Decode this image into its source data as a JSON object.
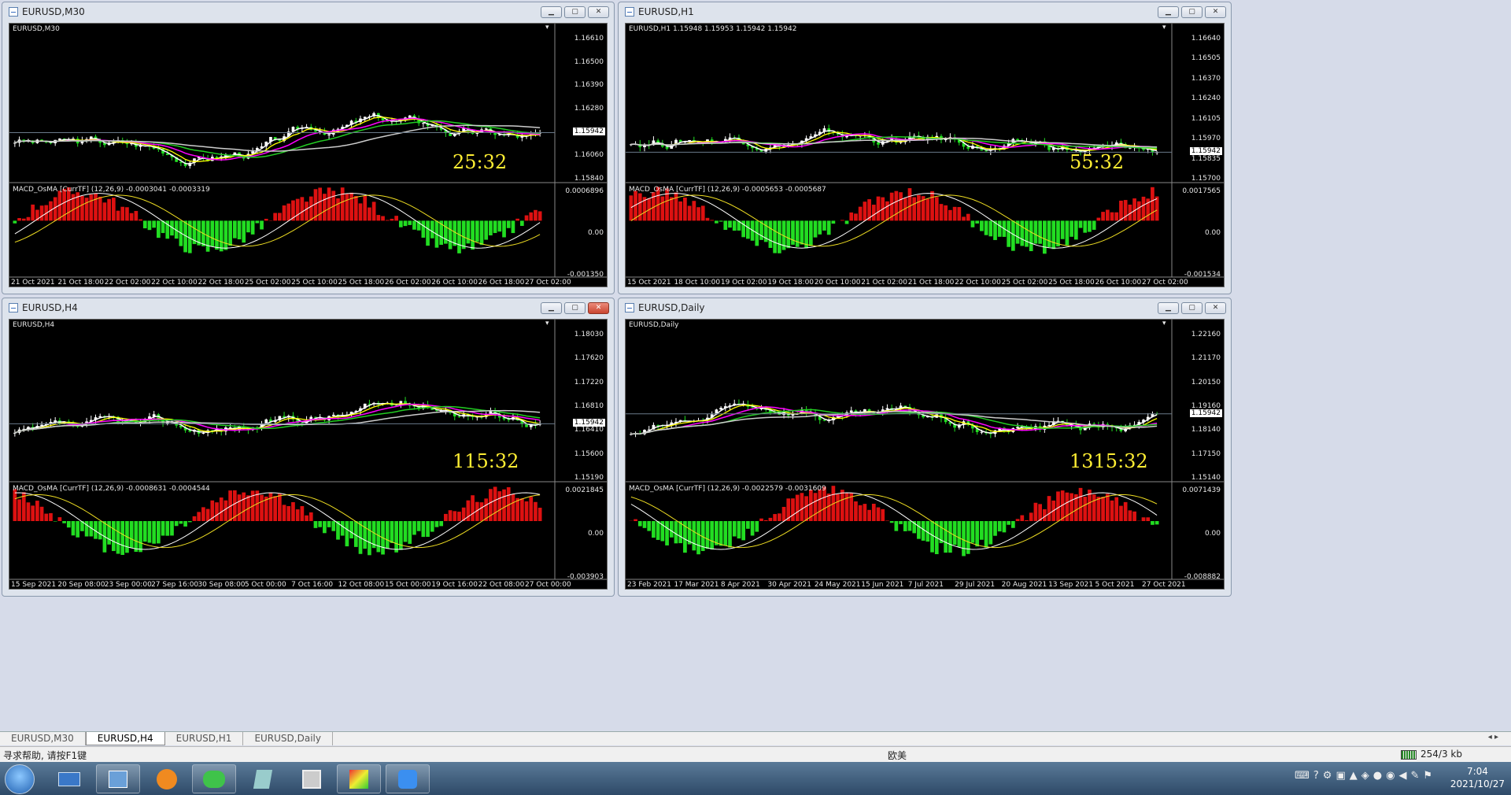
{
  "windows": [
    {
      "title": "EURUSD,M30",
      "header": "EURUSD,M30",
      "ind": "MACD_OsMA [CurrTF] (12,26,9) -0.0003041 -0.0003319",
      "timer": "25:32",
      "cur": "1.15942",
      "prices": [
        "1.16610",
        "1.16500",
        "1.16390",
        "1.16280",
        "1.16170",
        "1.16060",
        "1.15840"
      ],
      "ind_prices": [
        "0.0006896",
        "0.00",
        "-0.001350"
      ],
      "dates": [
        "21 Oct 2021",
        "21 Oct 18:00",
        "22 Oct 02:00",
        "22 Oct 10:00",
        "22 Oct 18:00",
        "25 Oct 02:00",
        "25 Oct 10:00",
        "25 Oct 18:00",
        "26 Oct 02:00",
        "26 Oct 10:00",
        "26 Oct 18:00",
        "27 Oct 02:00"
      ],
      "close_glyph": "x",
      "active": false
    },
    {
      "title": "EURUSD,H1",
      "header": "EURUSD,H1  1.15948 1.15953 1.15942 1.15942",
      "ind": "MACD_OsMA [CurrTF] (12,26,9) -0.0005653 -0.0005687",
      "timer": "55:32",
      "cur": "1.15942",
      "prices": [
        "1.16640",
        "1.16505",
        "1.16370",
        "1.16240",
        "1.16105",
        "1.15970",
        "1.15835",
        "1.15700"
      ],
      "ind_prices": [
        "0.0017565",
        "0.00",
        "-0.001534"
      ],
      "dates": [
        "15 Oct 2021",
        "18 Oct 10:00",
        "19 Oct 02:00",
        "19 Oct 18:00",
        "20 Oct 10:00",
        "21 Oct 02:00",
        "21 Oct 18:00",
        "22 Oct 10:00",
        "25 Oct 02:00",
        "25 Oct 18:00",
        "26 Oct 10:00",
        "27 Oct 02:00"
      ],
      "close_glyph": "x",
      "active": false
    },
    {
      "title": "EURUSD,H4",
      "header": "EURUSD,H4",
      "ind": "MACD_OsMA [CurrTF] (12,26,9) -0.0008631 -0.0004544",
      "timer": "115:32",
      "cur": "1.15942",
      "prices": [
        "1.18030",
        "1.17620",
        "1.17220",
        "1.16810",
        "1.16410",
        "1.15600",
        "1.15190"
      ],
      "ind_prices": [
        "0.0021845",
        "0.00",
        "-0.003903"
      ],
      "dates": [
        "15 Sep 2021",
        "20 Sep 08:00",
        "23 Sep 00:00",
        "27 Sep 16:00",
        "30 Sep 08:00",
        "5 Oct 00:00",
        "7 Oct 16:00",
        "12 Oct 08:00",
        "15 Oct 00:00",
        "19 Oct 16:00",
        "22 Oct 08:00",
        "27 Oct 00:00"
      ],
      "close_glyph": "x",
      "active": true
    },
    {
      "title": "EURUSD,Daily",
      "header": "EURUSD,Daily",
      "ind": "MACD_OsMA [CurrTF] (12,26,9) -0.0022579 -0.0031609",
      "timer": "1315:32",
      "cur": "1.15942",
      "prices": [
        "1.22160",
        "1.21170",
        "1.20150",
        "1.19160",
        "1.18140",
        "1.17150",
        "1.15140"
      ],
      "ind_prices": [
        "0.0071439",
        "0.00",
        "-0.008882"
      ],
      "dates": [
        "23 Feb 2021",
        "17 Mar 2021",
        "8 Apr 2021",
        "30 Apr 2021",
        "24 May 2021",
        "15 Jun 2021",
        "7 Jul 2021",
        "29 Jul 2021",
        "20 Aug 2021",
        "13 Sep 2021",
        "5 Oct 2021",
        "27 Oct 2021"
      ],
      "close_glyph": "x",
      "active": false
    }
  ],
  "tabs": [
    "EURUSD,M30",
    "EURUSD,H4",
    "EURUSD,H1",
    "EURUSD,Daily"
  ],
  "active_tab": 1,
  "status": {
    "help": "寻求帮助, 请按F1键",
    "profile": "欧美",
    "traffic": "254/3 kb"
  },
  "clock": {
    "time": "7:04",
    "date": "2021/10/27"
  }
}
